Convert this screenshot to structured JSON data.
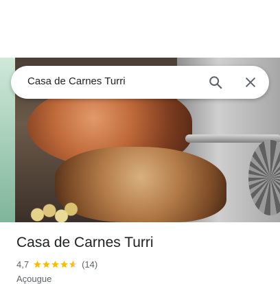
{
  "search": {
    "query": "Casa de Carnes Turri",
    "search_icon": "search-icon",
    "close_icon": "close-icon"
  },
  "place": {
    "title": "Casa de Carnes Turri",
    "rating": "4,7",
    "rating_value": 4.7,
    "review_count": "(14)",
    "category": "Açougue",
    "star_color": "#fbbc04"
  },
  "colors": {
    "text_primary": "#202124",
    "text_secondary": "#5f6368",
    "icon": "#5f6368"
  }
}
